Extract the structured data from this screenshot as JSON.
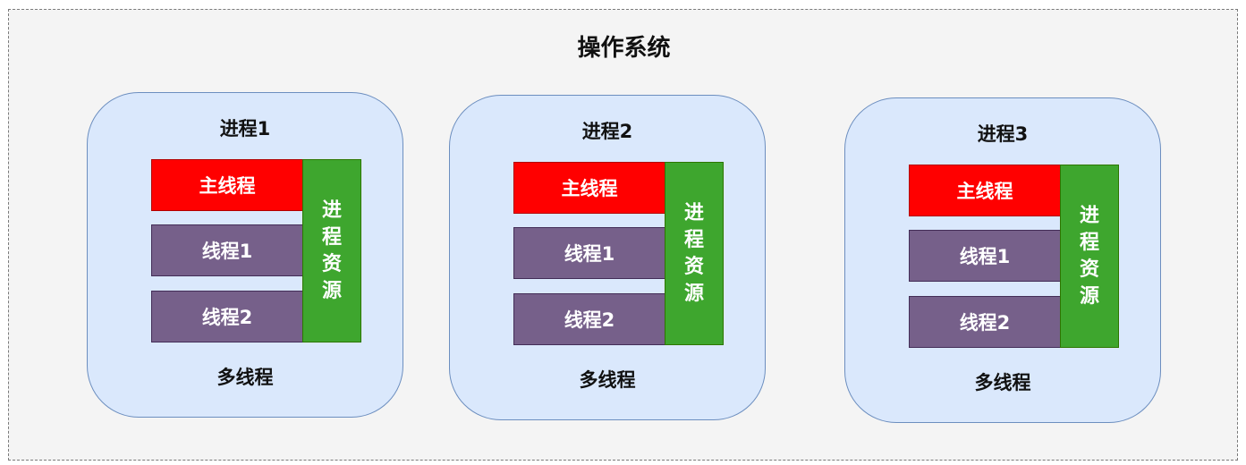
{
  "title": "操作系统",
  "processes": [
    {
      "name": "进程1",
      "main_thread": "主线程",
      "threads": [
        "线程1",
        "线程2"
      ],
      "resource_chars": [
        "进",
        "程",
        "资",
        "源"
      ],
      "footer": "多线程"
    },
    {
      "name": "进程2",
      "main_thread": "主线程",
      "threads": [
        "线程1",
        "线程2"
      ],
      "resource_chars": [
        "进",
        "程",
        "资",
        "源"
      ],
      "footer": "多线程"
    },
    {
      "name": "进程3",
      "main_thread": "主线程",
      "threads": [
        "线程1",
        "线程2"
      ],
      "resource_chars": [
        "进",
        "程",
        "资",
        "源"
      ],
      "footer": "多线程"
    }
  ],
  "colors": {
    "main_thread": "#ff0000",
    "thread": "#76608a",
    "resource": "#3ea62e",
    "process_fill": "#dae8fc",
    "process_border": "#6c8ebf"
  }
}
